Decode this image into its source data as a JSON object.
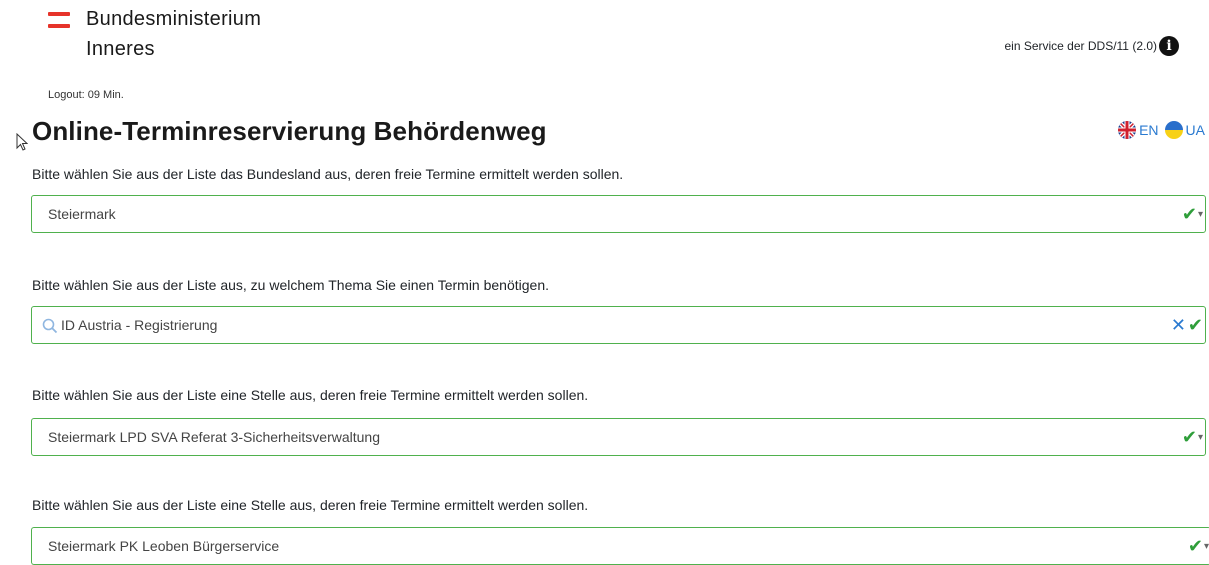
{
  "header": {
    "logo_line1": "Bundesministerium",
    "logo_line2": "Inneres",
    "service_text": "ein Service der DDS/11 (2.0)",
    "logout_text": "Logout: 09 Min."
  },
  "page": {
    "title": "Online-Terminreservierung Behördenweg",
    "languages": [
      {
        "code": "EN",
        "icon": "uk-flag-icon"
      },
      {
        "code": "UA",
        "icon": "ukraine-flag-icon"
      }
    ]
  },
  "form": {
    "fields": [
      {
        "question": "Bitte wählen Sie aus der Liste das Bundesland aus, deren freie Termine ermittelt werden sollen.",
        "value": "Steiermark"
      },
      {
        "question": "Bitte wählen Sie aus der Liste aus, zu welchem Thema Sie einen Termin benötigen.",
        "value": "ID Austria - Registrierung"
      },
      {
        "question": "Bitte wählen Sie aus der Liste eine Stelle aus, deren freie Termine ermittelt werden sollen.",
        "value": "Steiermark LPD SVA Referat 3-Sicherheitsverwaltung"
      },
      {
        "question": "Bitte wählen Sie aus der Liste eine Stelle aus, deren freie Termine ermittelt werden sollen.",
        "value": "Steiermark PK Leoben Bürgerservice"
      }
    ]
  },
  "colors": {
    "valid_border": "#4fb14d",
    "check": "#2f9e3a",
    "link": "#2a7ad0",
    "logo_red": "#e6332a"
  }
}
